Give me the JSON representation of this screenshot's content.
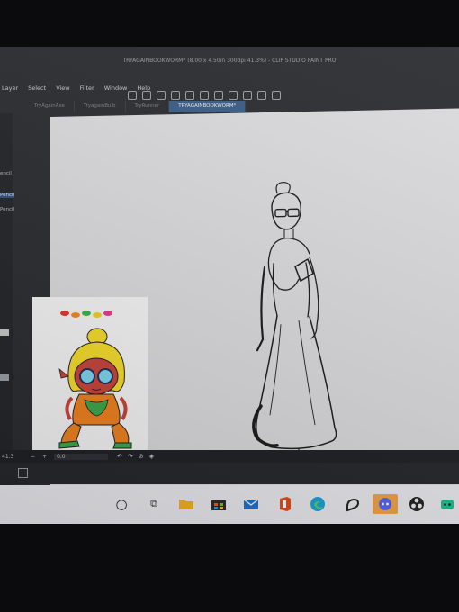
{
  "window": {
    "title": "TRYAGAINBOOKWORM* (8.00 x 4.50in 300dpi 41.3%) - CLIP STUDIO PAINT PRO"
  },
  "menu": [
    "Layer",
    "Select",
    "View",
    "Filter",
    "Window",
    "Help"
  ],
  "tabs": [
    {
      "label": "TryAgainAxe",
      "active": false
    },
    {
      "label": "TryagainBulb",
      "active": false
    },
    {
      "label": "TryRunner",
      "active": false
    },
    {
      "label": "TRYAGAINBOOKWORM*",
      "active": true
    }
  ],
  "tool_panel": {
    "items": [
      "encil",
      "Pencil",
      "Pencil"
    ]
  },
  "status": {
    "zoom": "41.3",
    "angle": "0.0",
    "minus": "−",
    "plus": "+"
  },
  "taskbar": {
    "icons": [
      "search-icon",
      "task-view-icon",
      "file-explorer-icon",
      "store-icon",
      "mail-icon",
      "office-icon",
      "edge-icon",
      "clip-studio-icon",
      "discord-icon",
      "obs-icon",
      "app-icon"
    ]
  },
  "colors": {
    "accent_tab": "#3b5d86",
    "canvas": "#dcdcde",
    "taskbar": "#ececf0"
  }
}
